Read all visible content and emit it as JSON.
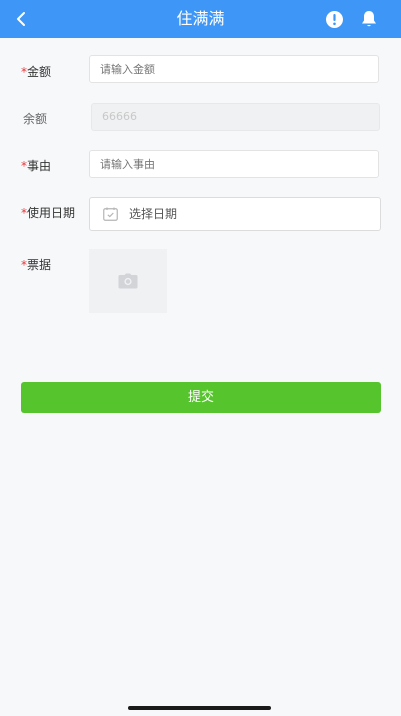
{
  "header": {
    "title": "住满满",
    "back_icon": "chevron-left-icon",
    "alert_icon": "alert-circle-icon",
    "bell_icon": "bell-icon",
    "bg_color": "#3e97f6"
  },
  "form": {
    "amount": {
      "required_mark": "*",
      "label": "金额",
      "placeholder": "请输入金额",
      "value": ""
    },
    "balance": {
      "label": "余额",
      "value": "66666"
    },
    "reason": {
      "required_mark": "*",
      "label": "事由",
      "placeholder": "请输入事由",
      "value": ""
    },
    "use_date": {
      "required_mark": "*",
      "label": "使用日期",
      "placeholder": "选择日期",
      "icon": "calendar-icon"
    },
    "receipt": {
      "required_mark": "*",
      "label": "票据",
      "icon": "camera-icon"
    }
  },
  "submit": {
    "label": "提交",
    "color": "#56c42d"
  }
}
